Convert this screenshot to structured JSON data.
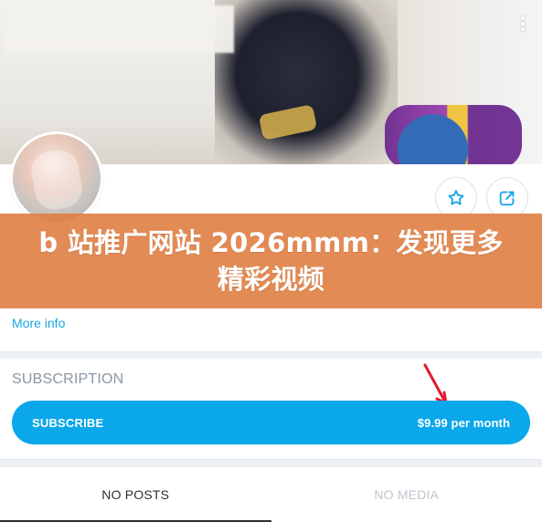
{
  "profile": {
    "more_info_label": "More info"
  },
  "banner": {
    "text": "b 站推广网站 2026mmm：发现更多精彩视频"
  },
  "subscription": {
    "section_title": "SUBSCRIPTION",
    "subscribe_label": "SUBSCRIBE",
    "price_text": "$9.99 per month"
  },
  "tabs": [
    {
      "label": "NO POSTS",
      "active": true
    },
    {
      "label": "NO MEDIA",
      "active": false
    }
  ],
  "icons": {
    "more": "more-vertical-icon",
    "favorite": "star-icon",
    "share": "share-icon",
    "annotation_arrow": "red-arrow-icon"
  },
  "colors": {
    "primary": "#0aa7ea",
    "link": "#1aa3e8",
    "banner_overlay": "#e07e43",
    "muted_label": "#8a96a3",
    "tab_active": "#2c2f33",
    "tab_inactive": "#bfc6ce",
    "annotation_red": "#e11d2e"
  }
}
